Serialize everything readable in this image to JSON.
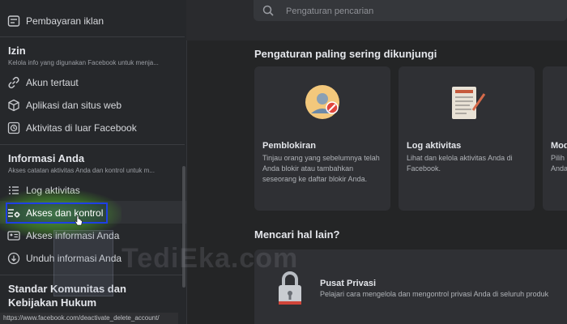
{
  "sidebar": {
    "items_top": [
      {
        "label": "Pembayaran iklan",
        "icon": "billing-icon"
      }
    ],
    "izin": {
      "title": "Izin",
      "subtitle": "Kelola info yang digunakan Facebook untuk menja...",
      "items": [
        {
          "label": "Akun tertaut",
          "icon": "link-icon"
        },
        {
          "label": "Aplikasi dan situs web",
          "icon": "cube-icon"
        },
        {
          "label": "Aktivitas di luar Facebook",
          "icon": "history-icon"
        }
      ]
    },
    "info": {
      "title": "Informasi Anda",
      "subtitle": "Akses catatan aktivitas Anda dan kontrol untuk m...",
      "items": [
        {
          "label": "Log aktivitas",
          "icon": "list-icon"
        },
        {
          "label": "Akses dan kontrol",
          "icon": "list-gear-icon"
        },
        {
          "label": "Akses informasi Anda",
          "icon": "id-card-icon"
        },
        {
          "label": "Unduh informasi Anda",
          "icon": "download-icon"
        }
      ]
    },
    "standards_title": "Standar Komunitas dan Kebijakan Hukum"
  },
  "status_url": "https://www.facebook.com/deactivate_delete_account/",
  "search": {
    "placeholder": "Pengaturan pencarian"
  },
  "frequent": {
    "heading": "Pengaturan paling sering dikunjungi",
    "cards": [
      {
        "title": "Pemblokiran",
        "desc": "Tinjau orang yang sebelumnya telah Anda blokir atau tambahkan seseorang ke daftar blokir Anda."
      },
      {
        "title": "Log aktivitas",
        "desc": "Lihat dan kelola aktivitas Anda di Facebook."
      },
      {
        "title": "Mod",
        "desc": "Pilih n Anda"
      }
    ]
  },
  "more": {
    "heading": "Mencari hal lain?",
    "privacy": {
      "title": "Pusat Privasi",
      "desc": "Pelajari cara mengelola dan mengontrol privasi Anda di seluruh produk"
    }
  },
  "watermark": "TediEka.com"
}
